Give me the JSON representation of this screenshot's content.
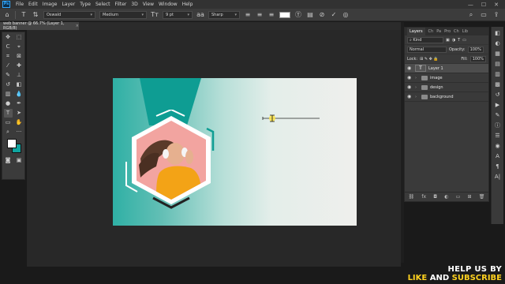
{
  "app": {
    "logo": "Ps",
    "menu": [
      "File",
      "Edit",
      "Image",
      "Layer",
      "Type",
      "Select",
      "Filter",
      "3D",
      "View",
      "Window",
      "Help"
    ],
    "window_controls": [
      "—",
      "☐",
      "✕"
    ]
  },
  "options_bar": {
    "font_family": "Oswald",
    "font_style": "Medium",
    "font_size": "9 pt",
    "antialias": "Sharp"
  },
  "document_tab": {
    "label": "web banner @ 66.7% (Layer 1, RGB/8)",
    "close": "×"
  },
  "layers_panel": {
    "tabs": [
      "Layers",
      "Ch",
      "Pa",
      "Pro",
      "Ch",
      "Lib"
    ],
    "filter_placeholder": "Kind",
    "blend_mode": "Normal",
    "opacity_label": "Opacity:",
    "opacity_value": "100%",
    "lock_label": "Lock:",
    "fill_label": "Fill:",
    "fill_value": "100%",
    "layers": [
      {
        "name": "Layer 1",
        "type": "text",
        "selected": true
      },
      {
        "name": "image",
        "type": "group",
        "selected": false
      },
      {
        "name": "design",
        "type": "group",
        "selected": false
      },
      {
        "name": "background",
        "type": "group",
        "selected": false
      }
    ]
  },
  "toolbar": {
    "foreground_color": "#ffffff",
    "background_color": "#0fa5a0"
  },
  "promo": {
    "line1": "HELP US BY",
    "line2_a": "LIKE",
    "line2_b": "AND",
    "line2_c": "SUBSCRIBE"
  }
}
